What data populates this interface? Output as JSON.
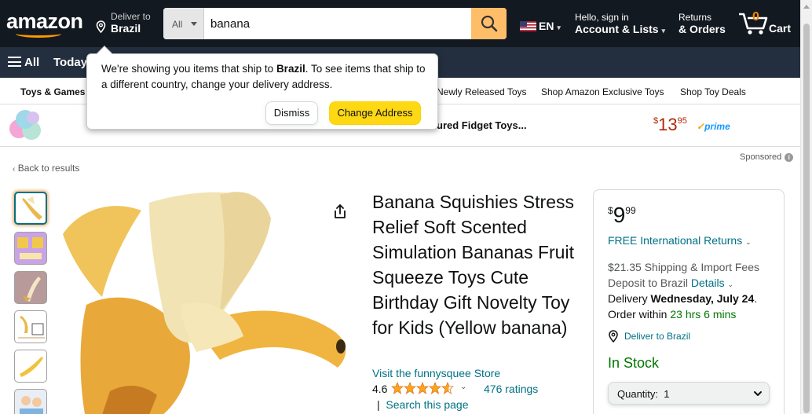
{
  "header": {
    "logo": "amazon",
    "deliver_line1": "Deliver to",
    "deliver_line2": "Brazil",
    "search_category": "All",
    "search_value": "banana",
    "lang": "EN",
    "account_line1": "Hello, sign in",
    "account_line2": "Account & Lists",
    "returns_line1": "Returns",
    "returns_line2": "& Orders",
    "cart_count": "0",
    "cart_label": "Cart"
  },
  "nav": {
    "all_label": "All",
    "today_label": "Today's"
  },
  "subnav": {
    "items": [
      "Toys & Games",
      "Newly Released Toys",
      "Shop Amazon Exclusive Toys",
      "Shop Toy Deals"
    ]
  },
  "ad": {
    "title": "ured Fidget Toys...",
    "price_symbol": "$",
    "price_whole": "13",
    "price_fraction": "95",
    "prime": "prime"
  },
  "popover": {
    "msg_part1": "We're showing you items that ship to ",
    "msg_bold": "Brazil",
    "msg_part2": ". To see items that ship to a different country, change your delivery address.",
    "dismiss_label": "Dismiss",
    "change_label": "Change Address"
  },
  "page": {
    "back_label": "Back to results",
    "sponsored_label": "Sponsored"
  },
  "product": {
    "title": "Banana Squishies Stress Relief Soft Scented Simulation Bananas Fruit Squeeze Toys Cute Birthday Gift Novelty Toy for Kids (Yellow banana)",
    "store_link": "Visit the funnysquee Store",
    "rating": "4.6",
    "rating_stars": 4.6,
    "ratings_count": "476 ratings",
    "search_page_sep": "|",
    "search_page_label": "Search this page"
  },
  "buybox": {
    "price_symbol": "$",
    "price_whole": "9",
    "price_fraction": "99",
    "returns_label": "FREE International Returns",
    "ship_fees": "$21.35 Shipping & Import Fees Deposit to Brazil",
    "details_label": "Details",
    "delivery_prefix": "Delivery ",
    "delivery_date": "Wednesday, July 24",
    "delivery_suffix": ".",
    "order_within_prefix": "Order within ",
    "order_within_time": "23 hrs 6 mins",
    "deliver_to_label": "Deliver to Brazil",
    "stock_label": "In Stock",
    "qty_label": "Quantity:",
    "qty_value": "1"
  },
  "icons": {
    "search": "search-icon",
    "pin": "location-pin-icon",
    "cart": "cart-icon",
    "share": "share-icon",
    "flag": "us-flag-icon"
  },
  "colors": {
    "header_bg": "#131921",
    "nav_bg": "#232f3e",
    "search_button": "#febd69",
    "accent": "#ff9900",
    "link": "#007185",
    "price_red": "#b12704",
    "in_stock_green": "#007600",
    "button_yellow": "#ffd814"
  }
}
